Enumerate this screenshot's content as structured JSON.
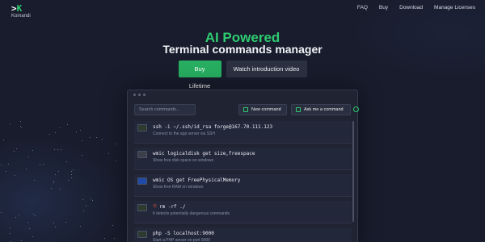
{
  "brand": {
    "mark_prefix": ">",
    "mark_letter": "K",
    "name": "Komandi"
  },
  "nav": {
    "items": [
      "FAQ",
      "Buy",
      "Download",
      "Manage Licenses"
    ]
  },
  "hero": {
    "title": "AI Powered",
    "subtitle": "Terminal commands manager",
    "primary_button": "Buy Lifetime",
    "secondary_button": "Watch introduction video"
  },
  "app": {
    "search_placeholder": "Search commands...",
    "new_command_label": "New command",
    "ask_label": "Ask me a command",
    "commands": [
      {
        "cmd": "ssh -i ~/.ssh/id_rsa forge@167.70.111.123",
        "desc": "Connect to the app server via SSH",
        "icon": "terminal-icon",
        "warn": false
      },
      {
        "cmd": "wmic logicaldisk get size,freespace",
        "desc": "Show free disk space on windows",
        "icon": "cmd-icon",
        "warn": false
      },
      {
        "cmd": "wmic OS get FreePhysicalMemory",
        "desc": "Show free RAM on windows",
        "icon": "powershell-icon",
        "warn": false
      },
      {
        "cmd": "rm -rf ./",
        "desc": "It detects potentially dangerous commands",
        "icon": "terminal-icon",
        "warn": true
      },
      {
        "cmd": "php -S localhost:9000",
        "desc": "Start a PHP server on port 9000",
        "icon": "terminal-icon",
        "warn": false
      }
    ]
  },
  "colors": {
    "accent": "#2ecc71",
    "background": "#181c2c",
    "danger": "#e74c3c"
  }
}
